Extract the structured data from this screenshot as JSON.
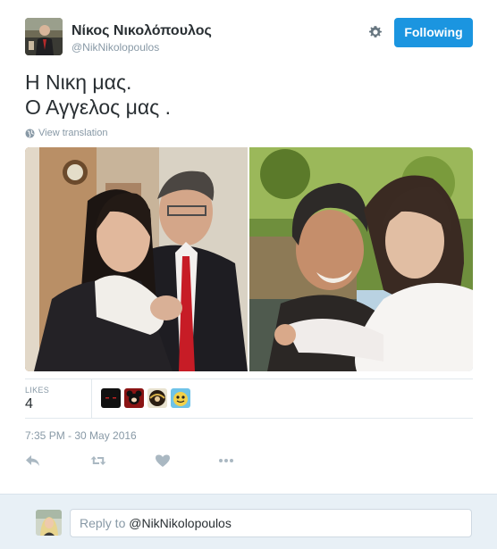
{
  "author": {
    "name": "Νίκος Νικολόπουλος",
    "handle": "@NikNikolopoulos"
  },
  "follow_label": "Following",
  "tweet_text": [
    "Η Νικη μας.",
    "Ο Αγγελος μας ."
  ],
  "translate_label": "View translation",
  "likes": {
    "label": "LIKES",
    "count": "4"
  },
  "timestamp": "7:35 PM - 30 May 2016",
  "actions": [
    "reply-icon",
    "retweet-icon",
    "like-icon",
    "more-icon"
  ],
  "reply": {
    "prefix": "Reply to ",
    "mention": "@NikNikolopoulos"
  },
  "colors": {
    "accent": "#1b95e0",
    "muted": "#8899a6",
    "reply_bar": "#e8f0f6"
  }
}
